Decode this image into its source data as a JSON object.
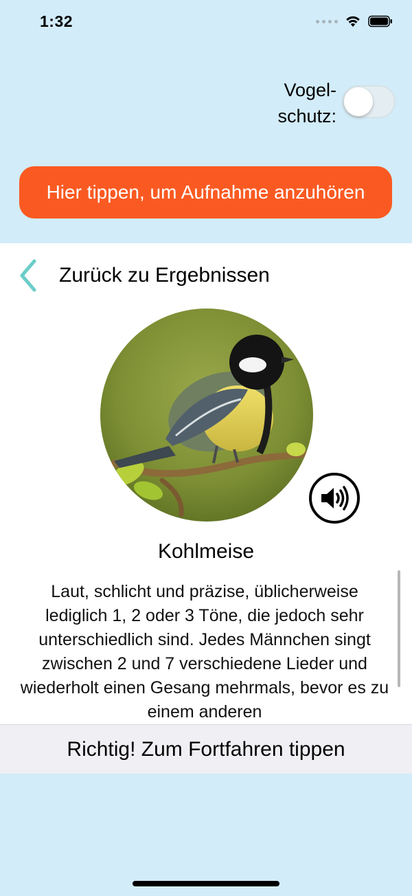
{
  "status_bar": {
    "time": "1:32",
    "icons": [
      "signal-dots-icon",
      "wifi-icon",
      "battery-icon"
    ]
  },
  "header": {
    "toggle_label": "Vogel-\nschutz:",
    "toggle_on": false,
    "listen_button": "Hier tippen, um Aufnahme anzuhören"
  },
  "card": {
    "back_label": "Zurück zu Ergebnissen",
    "bird_name": "Kohlmeise",
    "description": "Laut, schlicht und präzise, üblicherweise lediglich 1, 2 oder 3 Töne, die jedoch sehr unterschiedlich sind. Jedes Männchen singt zwischen 2 und 7 verschiedene Lieder und wiederholt einen Gesang mehrmals, bevor es zu einem anderen"
  },
  "footer": {
    "continue_label": "Richtig! Zum Fortfahren tippen"
  },
  "colors": {
    "background": "#d2ecf9",
    "accent_orange": "#fa5a22",
    "chevron_teal": "#6ccdc9",
    "footer_bg": "#efeff4"
  }
}
